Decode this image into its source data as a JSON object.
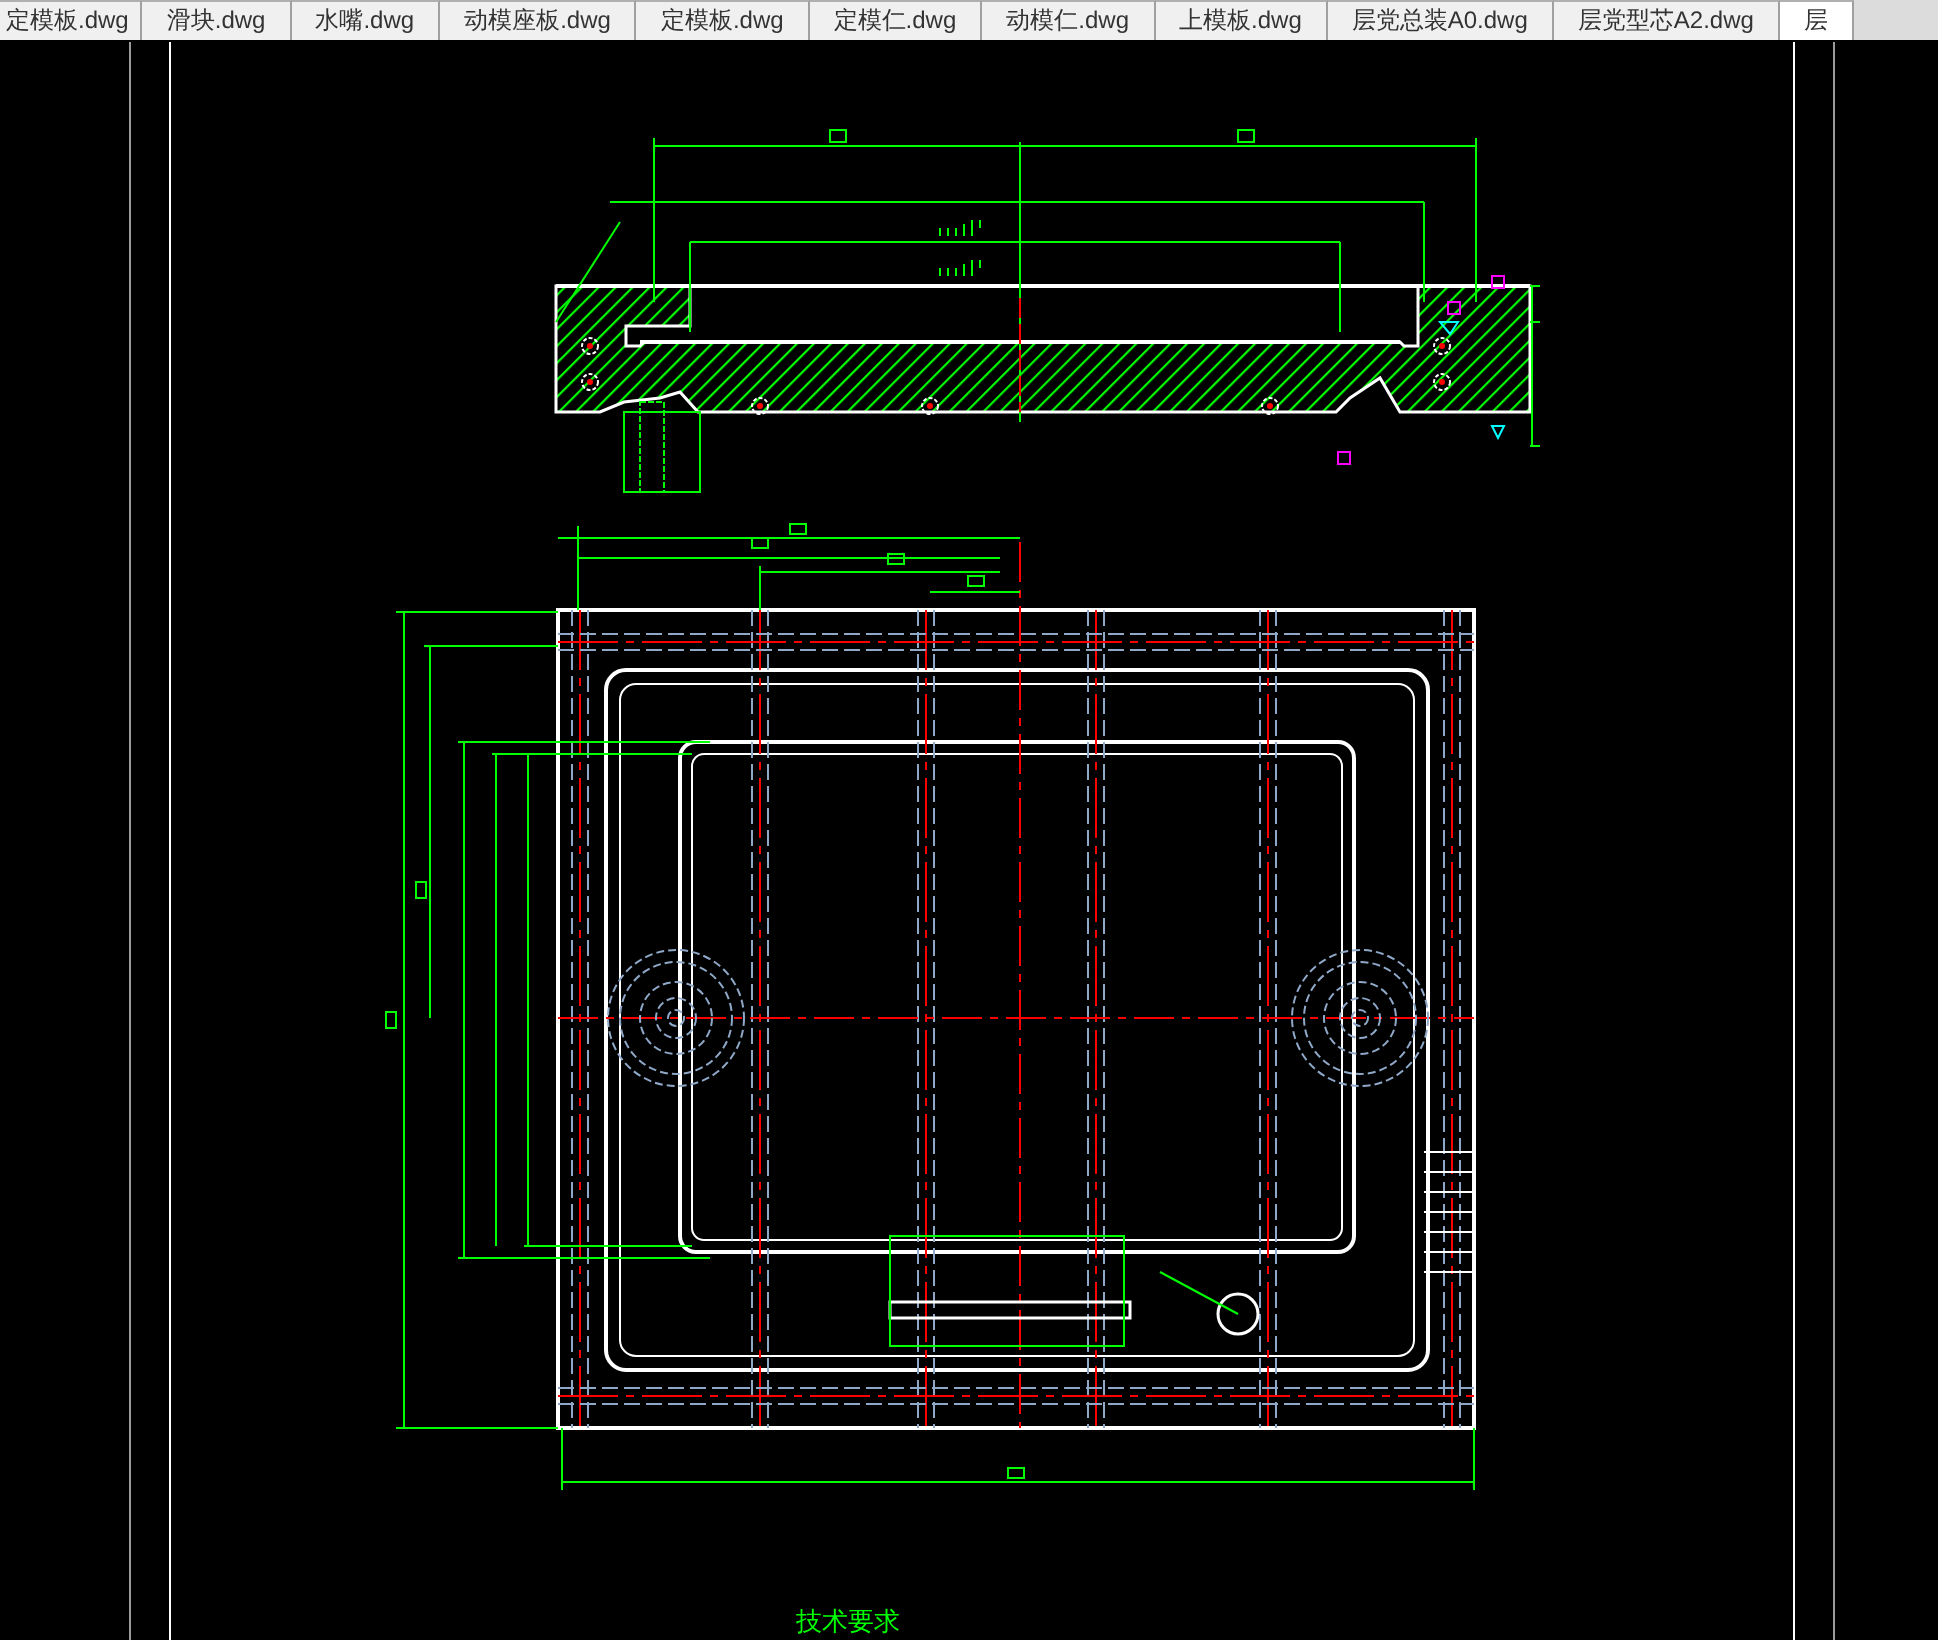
{
  "tabs": [
    {
      "label": "定模板.dwg",
      "selected": false
    },
    {
      "label": "滑块.dwg",
      "selected": false
    },
    {
      "label": "水嘴.dwg",
      "selected": false
    },
    {
      "label": "动模座板.dwg",
      "selected": false
    },
    {
      "label": "定模板.dwg",
      "selected": false
    },
    {
      "label": "定模仁.dwg",
      "selected": false
    },
    {
      "label": "动模仁.dwg",
      "selected": false
    },
    {
      "label": "上模板.dwg",
      "selected": false
    },
    {
      "label": "层党总装A0.dwg",
      "selected": false
    },
    {
      "label": "层党型芯A2.dwg",
      "selected": false
    },
    {
      "label": "层",
      "selected": true
    }
  ],
  "canvas": {
    "note_heading": "技术要求"
  }
}
